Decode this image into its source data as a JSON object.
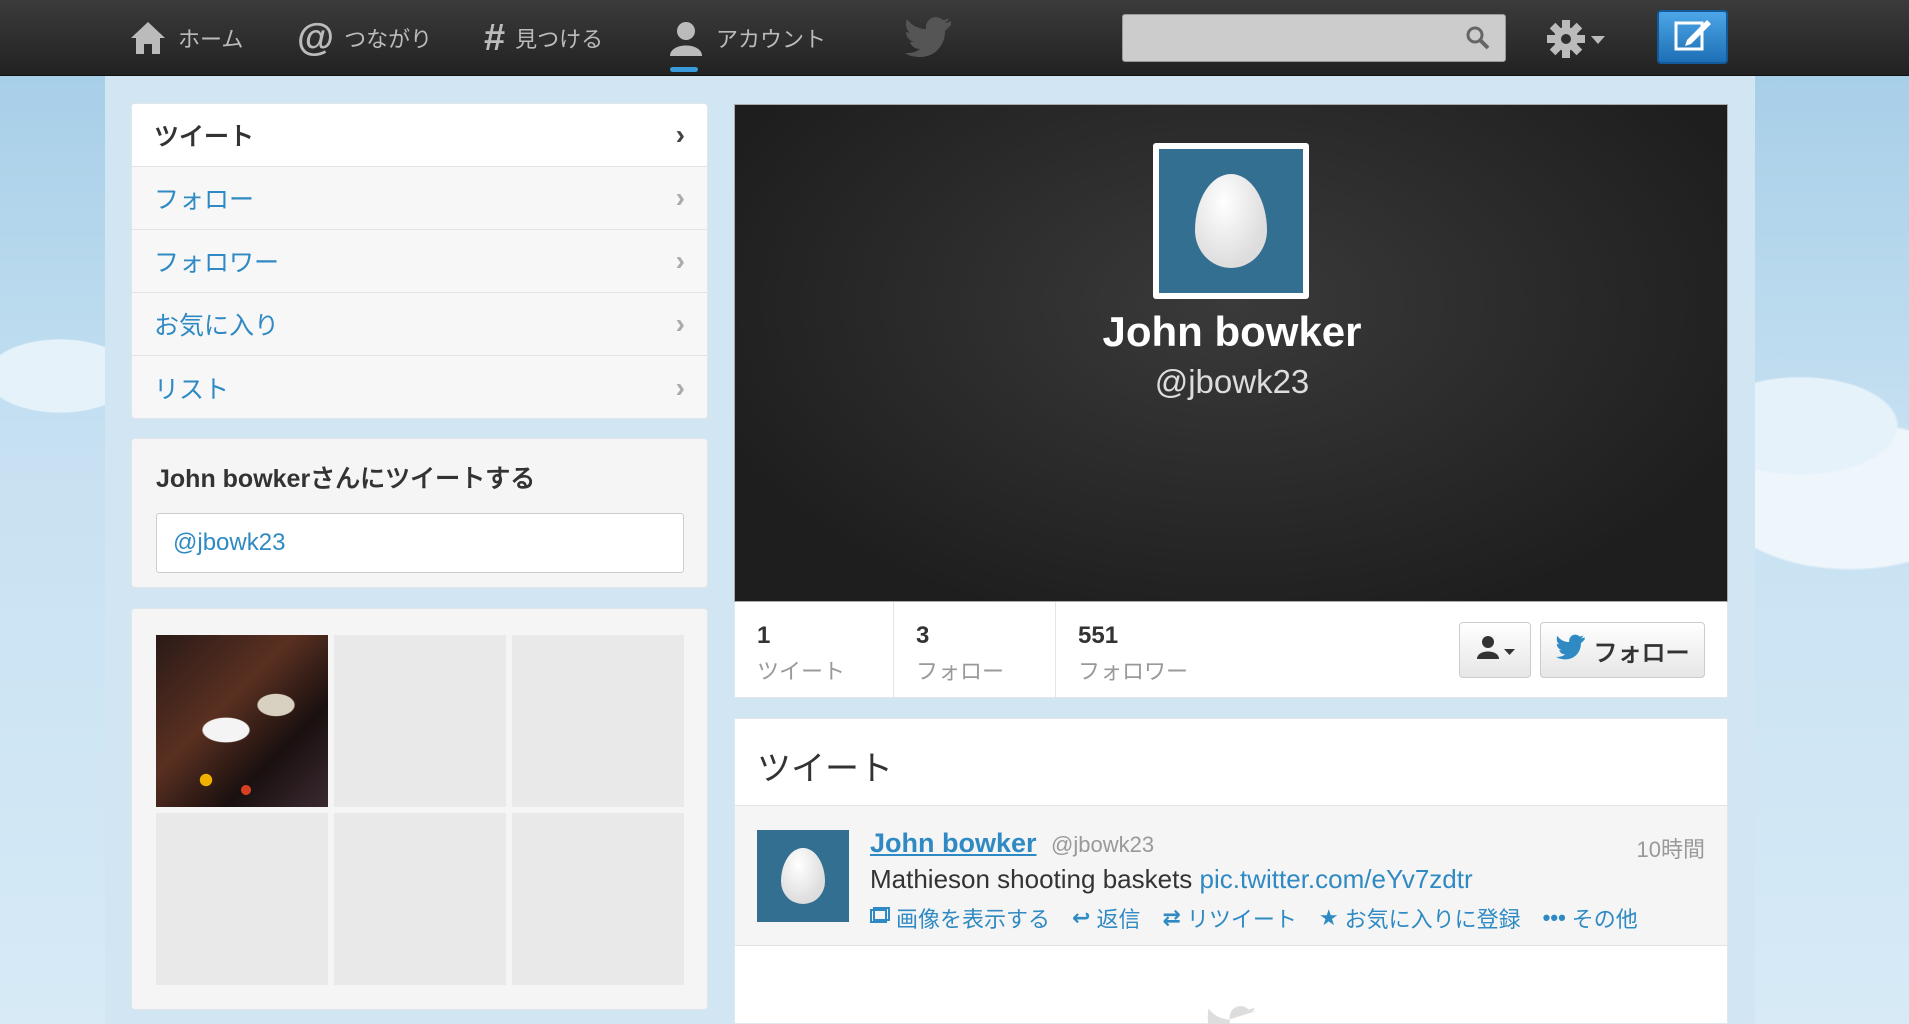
{
  "nav": {
    "home": "ホーム",
    "connect": "つながり",
    "discover": "見つける",
    "account": "アカウント"
  },
  "search": {
    "placeholder": ""
  },
  "sidebar": {
    "items": [
      {
        "label": "ツイート",
        "active": true
      },
      {
        "label": "フォロー"
      },
      {
        "label": "フォロワー"
      },
      {
        "label": "お気に入り"
      },
      {
        "label": "リスト"
      }
    ]
  },
  "tweet_to": {
    "title": "John bowkerさんにツイートする",
    "value": "@jbowk23"
  },
  "profile": {
    "name": "John bowker",
    "handle": "@jbowk23",
    "banner_color": "#1e1e1e",
    "avatar_color": "#336f91"
  },
  "stats": {
    "tweets_count": "1",
    "tweets_label": "ツイート",
    "following_count": "3",
    "following_label": "フォロー",
    "followers_count": "551",
    "followers_label": "フォロワー",
    "follow_button": "フォロー"
  },
  "timeline": {
    "header": "ツイート",
    "tweets": [
      {
        "name": "John bowker",
        "handle": "@jbowk23",
        "time": "10時間",
        "text": "Mathieson shooting baskets ",
        "link": "pic.twitter.com/eYv7zdtr",
        "actions": {
          "view_media": "画像を表示する",
          "reply": "返信",
          "retweet": "リツイート",
          "favorite": "お気に入りに登録",
          "more": "その他"
        }
      }
    ]
  },
  "colors": {
    "accent": "#2f8ac3",
    "topbar": "#2b2b2b",
    "background": "#c4dff0"
  }
}
